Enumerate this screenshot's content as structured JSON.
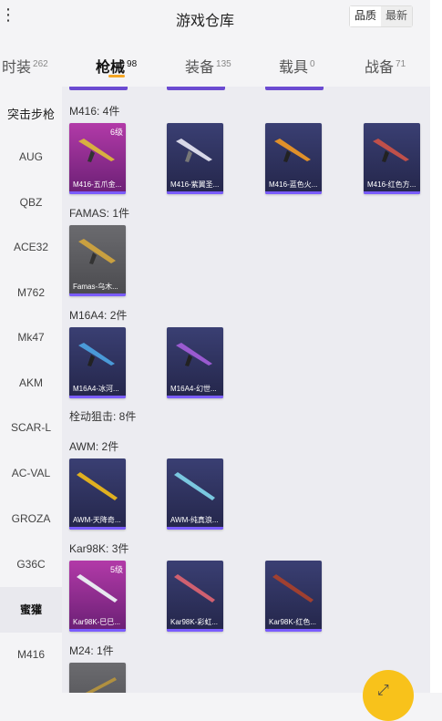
{
  "header": {
    "back_icon": "back-icon",
    "title": "游戏仓库",
    "sort": {
      "quality": "品质",
      "latest": "最新"
    }
  },
  "tabs": [
    {
      "label": "时装",
      "count": "262"
    },
    {
      "label": "枪械",
      "count": "98"
    },
    {
      "label": "装备",
      "count": "135"
    },
    {
      "label": "载具",
      "count": "0"
    },
    {
      "label": "战备",
      "count": "71"
    }
  ],
  "sidebar": [
    "突击步枪",
    "AUG",
    "QBZ",
    "ACE32",
    "M762",
    "Mk47",
    "AKM",
    "SCAR-L",
    "AC-VAL",
    "GROZA",
    "G36C",
    "蜜獾",
    "M416"
  ],
  "groups": {
    "m416": "M416: 4件",
    "famas": "FAMAS: 1件",
    "m16a4": "M16A4: 2件",
    "bolt": "栓动狙击: 8件",
    "awm": "AWM: 2件",
    "kar98k": "Kar98K: 3件",
    "m24": "M24: 1件"
  },
  "cards": {
    "m416_1": {
      "name": "M416-五爪金...",
      "level": "6级"
    },
    "m416_2": {
      "name": "M416-紫翼圣..."
    },
    "m416_3": {
      "name": "M416-蓝色火..."
    },
    "m416_4": {
      "name": "M416-红色方..."
    },
    "famas_1": {
      "name": "Famas-乌木..."
    },
    "m16_1": {
      "name": "M16A4-冰河..."
    },
    "m16_2": {
      "name": "M16A4-幻世..."
    },
    "awm_1": {
      "name": "AWM-天降奇..."
    },
    "awm_2": {
      "name": "AWM-纯真浪..."
    },
    "kar_1": {
      "name": "Kar98K-巳巳...",
      "level": "5级"
    },
    "kar_2": {
      "name": "Kar98K-彩虹..."
    },
    "kar_3": {
      "name": "Kar98K-红色..."
    }
  },
  "colors": {
    "accent": "#f5a623",
    "legendary": "#b23aa8",
    "epic": "#3a3f73",
    "rare": "#6b6b6f"
  }
}
